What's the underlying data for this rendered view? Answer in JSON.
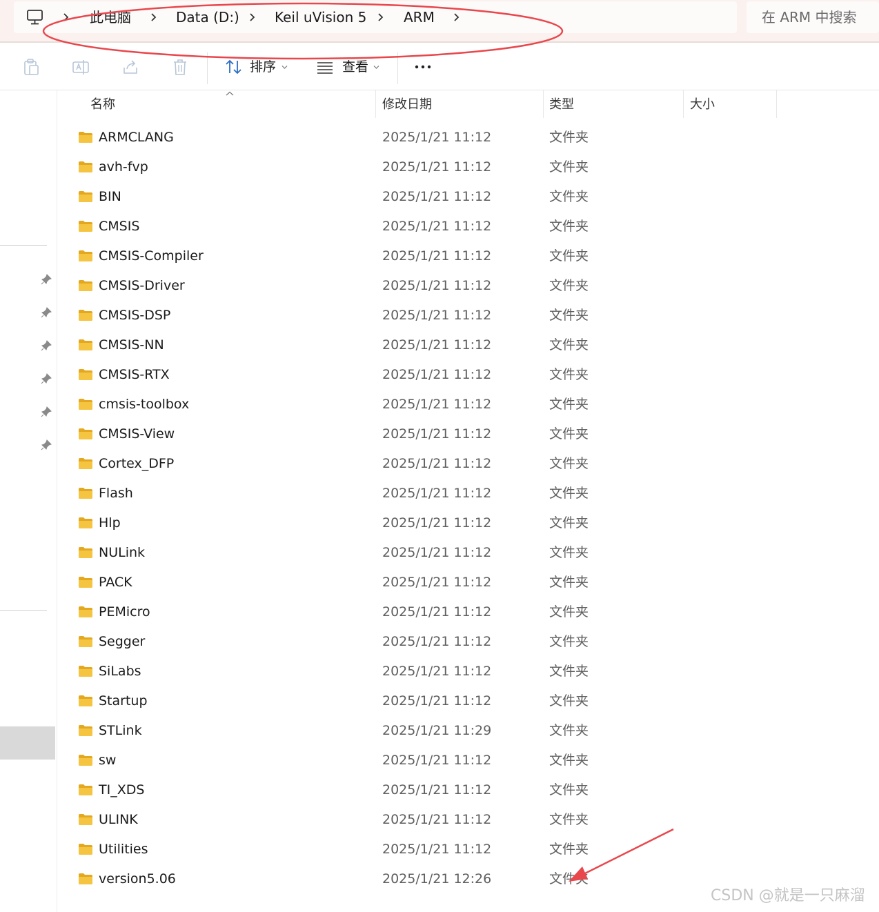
{
  "breadcrumb": {
    "items": [
      "此电脑",
      "Data (D:)",
      "Keil uVision 5",
      "ARM"
    ]
  },
  "search": {
    "placeholder": "在 ARM 中搜索"
  },
  "commandbar": {
    "sort_label": "排序",
    "view_label": "查看"
  },
  "columns": {
    "name": "名称",
    "date": "修改日期",
    "type": "类型",
    "size": "大小"
  },
  "files": [
    {
      "name": "ARMCLANG",
      "date": "2025/1/21 11:12",
      "type": "文件夹"
    },
    {
      "name": "avh-fvp",
      "date": "2025/1/21 11:12",
      "type": "文件夹"
    },
    {
      "name": "BIN",
      "date": "2025/1/21 11:12",
      "type": "文件夹"
    },
    {
      "name": "CMSIS",
      "date": "2025/1/21 11:12",
      "type": "文件夹"
    },
    {
      "name": "CMSIS-Compiler",
      "date": "2025/1/21 11:12",
      "type": "文件夹"
    },
    {
      "name": "CMSIS-Driver",
      "date": "2025/1/21 11:12",
      "type": "文件夹"
    },
    {
      "name": "CMSIS-DSP",
      "date": "2025/1/21 11:12",
      "type": "文件夹"
    },
    {
      "name": "CMSIS-NN",
      "date": "2025/1/21 11:12",
      "type": "文件夹"
    },
    {
      "name": "CMSIS-RTX",
      "date": "2025/1/21 11:12",
      "type": "文件夹"
    },
    {
      "name": "cmsis-toolbox",
      "date": "2025/1/21 11:12",
      "type": "文件夹"
    },
    {
      "name": "CMSIS-View",
      "date": "2025/1/21 11:12",
      "type": "文件夹"
    },
    {
      "name": "Cortex_DFP",
      "date": "2025/1/21 11:12",
      "type": "文件夹"
    },
    {
      "name": "Flash",
      "date": "2025/1/21 11:12",
      "type": "文件夹"
    },
    {
      "name": "Hlp",
      "date": "2025/1/21 11:12",
      "type": "文件夹"
    },
    {
      "name": "NULink",
      "date": "2025/1/21 11:12",
      "type": "文件夹"
    },
    {
      "name": "PACK",
      "date": "2025/1/21 11:12",
      "type": "文件夹"
    },
    {
      "name": "PEMicro",
      "date": "2025/1/21 11:12",
      "type": "文件夹"
    },
    {
      "name": "Segger",
      "date": "2025/1/21 11:12",
      "type": "文件夹"
    },
    {
      "name": "SiLabs",
      "date": "2025/1/21 11:12",
      "type": "文件夹"
    },
    {
      "name": "Startup",
      "date": "2025/1/21 11:12",
      "type": "文件夹"
    },
    {
      "name": "STLink",
      "date": "2025/1/21 11:29",
      "type": "文件夹"
    },
    {
      "name": "sw",
      "date": "2025/1/21 11:12",
      "type": "文件夹"
    },
    {
      "name": "TI_XDS",
      "date": "2025/1/21 11:12",
      "type": "文件夹"
    },
    {
      "name": "ULINK",
      "date": "2025/1/21 11:12",
      "type": "文件夹"
    },
    {
      "name": "Utilities",
      "date": "2025/1/21 11:12",
      "type": "文件夹"
    },
    {
      "name": "version5.06",
      "date": "2025/1/21 12:26",
      "type": "文件夹"
    }
  ],
  "watermark": "CSDN @就是一只麻溜",
  "colors": {
    "annotation": "#e8474c",
    "folder": "#f5c542",
    "folder_dark": "#e3a81e"
  }
}
